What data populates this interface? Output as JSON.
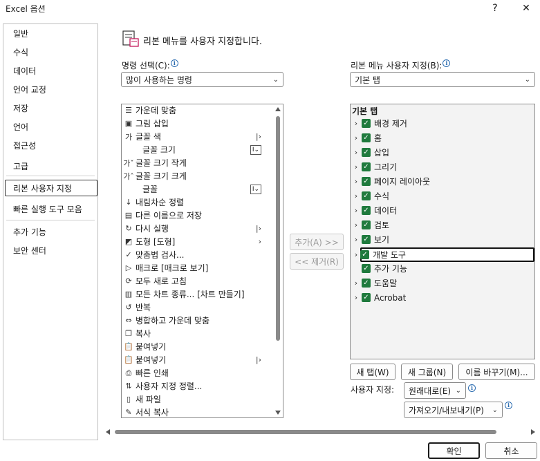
{
  "window": {
    "title": "Excel 옵션",
    "help_label": "?",
    "close_label": "✕"
  },
  "nav": {
    "items": [
      {
        "label": "일반"
      },
      {
        "label": "수식"
      },
      {
        "label": "데이터"
      },
      {
        "label": "언어 교정"
      },
      {
        "label": "저장"
      },
      {
        "label": "언어"
      },
      {
        "label": "접근성"
      },
      {
        "label": "고급"
      },
      {
        "label": "리본 사용자 지정"
      },
      {
        "label": "빠른 실행 도구 모음"
      },
      {
        "label": "추가 기능"
      },
      {
        "label": "보안 센터"
      }
    ],
    "selected": "리본 사용자 지정"
  },
  "header": {
    "title": "리본 메뉴를 사용자 지정합니다."
  },
  "left": {
    "choose_label": "명령 선택(C):",
    "choose_value": "많이 사용하는 명령",
    "commands": [
      {
        "icon": "align-center-icon",
        "glyph": "☰",
        "label": "가운데 맞춤",
        "suffix": ""
      },
      {
        "icon": "picture-icon",
        "glyph": "▣",
        "label": "그림 삽입",
        "suffix": ""
      },
      {
        "icon": "font-color-icon",
        "glyph": "가",
        "label": "글꼴 색",
        "suffix": "split"
      },
      {
        "icon": "",
        "glyph": "",
        "label": "글꼴 크기",
        "suffix": "box"
      },
      {
        "icon": "decrease-font-icon",
        "glyph": "가ˇ",
        "label": "글꼴 크기 작게",
        "suffix": ""
      },
      {
        "icon": "increase-font-icon",
        "glyph": "가ˆ",
        "label": "글꼴 크기 크게",
        "suffix": ""
      },
      {
        "icon": "",
        "glyph": "",
        "label": "글꼴",
        "suffix": "box"
      },
      {
        "icon": "sort-desc-icon",
        "glyph": "↓",
        "label": "내림차순 정렬",
        "suffix": ""
      },
      {
        "icon": "save-as-icon",
        "glyph": "▤",
        "label": "다른 이름으로 저장",
        "suffix": ""
      },
      {
        "icon": "redo-icon",
        "glyph": "↻",
        "label": "다시 실행",
        "suffix": "split"
      },
      {
        "icon": "shapes-icon",
        "glyph": "◩",
        "label": "도형 [도형]",
        "suffix": "arrow"
      },
      {
        "icon": "spelling-icon",
        "glyph": "✓",
        "label": "맞춤법 검사...",
        "suffix": ""
      },
      {
        "icon": "macro-icon",
        "glyph": "▷",
        "label": "매크로 [매크로 보기]",
        "suffix": ""
      },
      {
        "icon": "refresh-all-icon",
        "glyph": "⟳",
        "label": "모두 새로 고침",
        "suffix": ""
      },
      {
        "icon": "all-charts-icon",
        "glyph": "▥",
        "label": "모든 차트 종류... [차트 만들기]",
        "suffix": ""
      },
      {
        "icon": "repeat-icon",
        "glyph": "↺",
        "label": "반복",
        "suffix": ""
      },
      {
        "icon": "merge-center-icon",
        "glyph": "⇔",
        "label": "병합하고 가운데 맞춤",
        "suffix": ""
      },
      {
        "icon": "copy-icon",
        "glyph": "❐",
        "label": "복사",
        "suffix": ""
      },
      {
        "icon": "paste-icon",
        "glyph": "📋",
        "label": "붙여넣기",
        "suffix": ""
      },
      {
        "icon": "paste-icon",
        "glyph": "📋",
        "label": "붙여넣기",
        "suffix": "split"
      },
      {
        "icon": "quick-print-icon",
        "glyph": "⎙",
        "label": "빠른 인쇄",
        "suffix": ""
      },
      {
        "icon": "custom-sort-icon",
        "glyph": "⇅",
        "label": "사용자 지정 정렬...",
        "suffix": ""
      },
      {
        "icon": "new-file-icon",
        "glyph": "▯",
        "label": "새 파일",
        "suffix": ""
      },
      {
        "icon": "format-painter-icon",
        "glyph": "✎",
        "label": "서식 복사",
        "suffix": ""
      }
    ]
  },
  "middle": {
    "add_label": "추가(A) >>",
    "remove_label": "<< 제거(R)"
  },
  "right": {
    "customize_label": "리본 메뉴 사용자 지정(B):",
    "customize_value": "기본 탭",
    "tree_header": "기본 탭",
    "tabs": [
      {
        "label": "배경 제거",
        "expander": true,
        "checked": true,
        "selected": false
      },
      {
        "label": "홈",
        "expander": true,
        "checked": true,
        "selected": false
      },
      {
        "label": "삽입",
        "expander": true,
        "checked": true,
        "selected": false
      },
      {
        "label": "그리기",
        "expander": true,
        "checked": true,
        "selected": false
      },
      {
        "label": "페이지 레이아웃",
        "expander": true,
        "checked": true,
        "selected": false
      },
      {
        "label": "수식",
        "expander": true,
        "checked": true,
        "selected": false
      },
      {
        "label": "데이터",
        "expander": true,
        "checked": true,
        "selected": false
      },
      {
        "label": "검토",
        "expander": true,
        "checked": true,
        "selected": false
      },
      {
        "label": "보기",
        "expander": true,
        "checked": true,
        "selected": false
      },
      {
        "label": "개발 도구",
        "expander": true,
        "checked": true,
        "selected": true
      },
      {
        "label": "추가 기능",
        "expander": false,
        "checked": true,
        "selected": false
      },
      {
        "label": "도움말",
        "expander": true,
        "checked": true,
        "selected": false
      },
      {
        "label": "Acrobat",
        "expander": true,
        "checked": true,
        "selected": false
      }
    ],
    "new_tab_label": "새 탭(W)",
    "new_group_label": "새 그룹(N)",
    "rename_label": "이름 바꾸기(M)...",
    "customizations_label": "사용자 지정:",
    "reset_label": "원래대로(E)",
    "import_export_label": "가져오기/내보내기(P)"
  },
  "footer": {
    "ok_label": "확인",
    "cancel_label": "취소"
  },
  "colors": {
    "check": "#1f7a3d",
    "info": "#2b6cb0"
  }
}
